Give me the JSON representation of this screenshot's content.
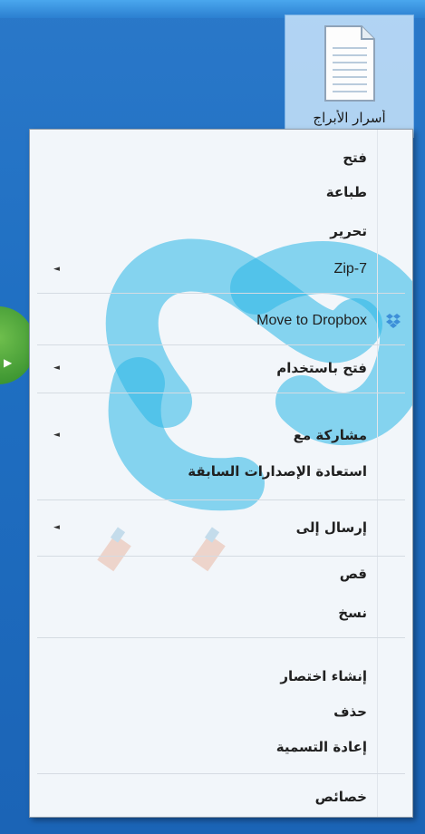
{
  "desktop": {
    "file_label": "أسرار الأبراج"
  },
  "context_menu": {
    "items": [
      {
        "label": "فتح",
        "has_submenu": false
      },
      {
        "label": "طباعة",
        "has_submenu": false
      },
      {
        "label": "تحرير",
        "has_submenu": false
      },
      {
        "label": "Zip-7",
        "has_submenu": true
      },
      {
        "label": "Move to Dropbox",
        "has_submenu": false,
        "icon": "dropbox-icon"
      },
      {
        "label": "فتح باستخدام",
        "has_submenu": true
      },
      {
        "label": "مشاركة مع",
        "has_submenu": true
      },
      {
        "label": "استعادة الإصدارات السابقة",
        "has_submenu": false
      },
      {
        "label": "إرسال إلى",
        "has_submenu": true
      },
      {
        "label": "قص",
        "has_submenu": false
      },
      {
        "label": "نسخ",
        "has_submenu": false
      },
      {
        "label": "إنشاء اختصار",
        "has_submenu": false
      },
      {
        "label": "حذف",
        "has_submenu": false
      },
      {
        "label": "إعادة التسمية",
        "has_submenu": false
      },
      {
        "label": "خصائص",
        "has_submenu": false
      }
    ],
    "submenu_glyph": "◄"
  },
  "colors": {
    "desktop_blue": "#1f6fc2",
    "menu_background": "#f2f6fa",
    "watermark_cyan": "#29b6e6",
    "dropbox_blue": "#3d8fd8"
  }
}
